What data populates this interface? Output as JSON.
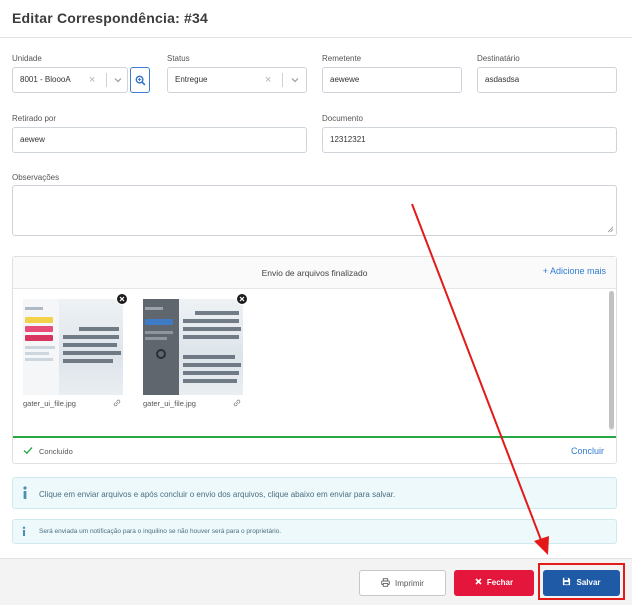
{
  "header": {
    "title": "Editar Correspondência: #34"
  },
  "form": {
    "unidade": {
      "label": "Unidade",
      "value": "8001 - BloooA"
    },
    "status": {
      "label": "Status",
      "value": "Entregue"
    },
    "remetente": {
      "label": "Remetente",
      "value": "aewewe"
    },
    "destinatario": {
      "label": "Destinatário",
      "value": "asdasdsa"
    },
    "retirado_por": {
      "label": "Retirado por",
      "value": "aewew"
    },
    "documento": {
      "label": "Documento",
      "value": "12312321"
    },
    "observacoes": {
      "label": "Observações",
      "value": ""
    }
  },
  "uploader": {
    "title": "Envio de arquivos finalizado",
    "add_more": "+ Adicione mais",
    "files": [
      {
        "name": "gater_ui_file.jpg"
      },
      {
        "name": "gater_ui_file.jpg"
      }
    ],
    "status": "Concluído",
    "finish": "Concluir"
  },
  "alerts": [
    {
      "text": "Clique em enviar arquivos e após concluir o envio dos arquivos, clique abaixo em enviar para salvar."
    },
    {
      "text": "Será enviada um notificação para o inquilino se não houver será para o proprietário."
    }
  ],
  "footer": {
    "print_label": "Imprimir",
    "close_label": "Fechar",
    "save_label": "Salvar"
  },
  "colors": {
    "primary": "#1f5aa6",
    "danger": "#e4163b",
    "success": "#27a844",
    "link": "#2f7bd1",
    "annotation": "#e21a1a"
  },
  "icons": [
    "zoom-icon",
    "close-icon",
    "chevron-down-icon",
    "link-icon",
    "check-icon",
    "info-icon",
    "printer-icon",
    "save-icon",
    "arrow-annotation"
  ]
}
